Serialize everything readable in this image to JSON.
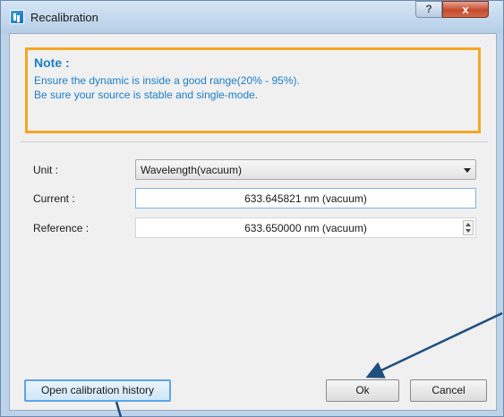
{
  "window": {
    "title": "Recalibration",
    "help_label": "?",
    "close_label": "x"
  },
  "note": {
    "title": "Note :",
    "lines": [
      "Ensure the dynamic is inside a good range(20% - 95%).",
      "Be sure your source is stable and single-mode."
    ],
    "accent_color": "#f5a623",
    "text_color": "#1c7ec6"
  },
  "form": {
    "unit": {
      "label": "Unit :",
      "value": "Wavelength(vacuum)"
    },
    "current": {
      "label": "Current :",
      "value": "633.645821 nm (vacuum)"
    },
    "reference": {
      "label": "Reference :",
      "value": "633.650000 nm (vacuum)"
    }
  },
  "buttons": {
    "history": "Open calibration history",
    "ok": "Ok",
    "cancel": "Cancel"
  },
  "icons": [
    "app-icon",
    "help-icon",
    "close-icon",
    "chevron-down-icon",
    "spin-up-icon",
    "spin-down-icon",
    "arrow-annotation"
  ]
}
